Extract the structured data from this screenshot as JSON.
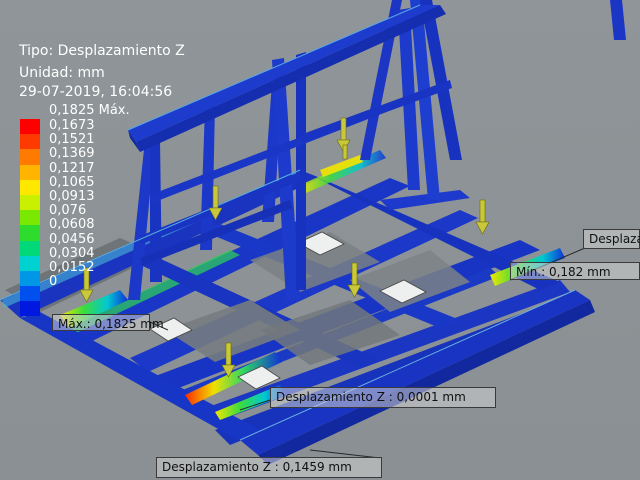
{
  "header": {
    "type_label": "Tipo: Desplazamiento Z",
    "unit_label": "Unidad: mm",
    "timestamp": "29-07-2019, 16:04:56"
  },
  "legend": {
    "max_label": "0,1825 Máx.",
    "items": [
      {
        "label": "0,1673",
        "color": "#ff3a00"
      },
      {
        "label": "0,1521",
        "color": "#ff7a00"
      },
      {
        "label": "0,1369",
        "color": "#ffb400"
      },
      {
        "label": "0,1217",
        "color": "#ffe800"
      },
      {
        "label": "0,1065",
        "color": "#c8f000"
      },
      {
        "label": "0,0913",
        "color": "#7ae800"
      },
      {
        "label": "0,076",
        "color": "#2edc2e"
      },
      {
        "label": "0,0608",
        "color": "#00d87a"
      },
      {
        "label": "0,0456",
        "color": "#00d2d2"
      },
      {
        "label": "0,0304",
        "color": "#0098e6"
      },
      {
        "label": "0,0152",
        "color": "#0050f0"
      },
      {
        "label": "0",
        "color": "#0018e0"
      }
    ],
    "top_color": "#ff0000"
  },
  "callouts": {
    "max": "Máx.: 0,1825 mm",
    "min": "Mín.: 0,182 mm",
    "desp_right": "Desplazam",
    "desp_center": "Desplazamiento Z : 0,0001 mm",
    "desp_bottom": "Desplazamiento Z : 0,1459 mm"
  },
  "colors": {
    "background": "#8e9497",
    "frame_blue": "#1f39c8",
    "load_arrow": "#c8c83a"
  }
}
